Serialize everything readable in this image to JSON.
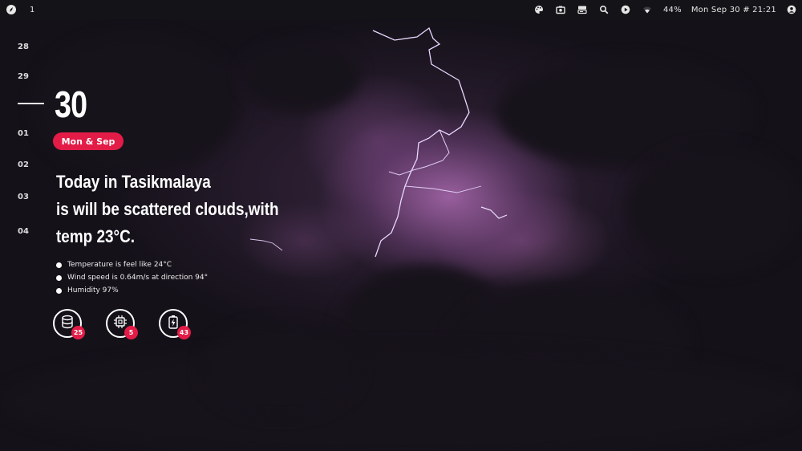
{
  "topbar": {
    "workspace": "1",
    "tray_icons": [
      "palette-icon",
      "camera-icon",
      "panel-icon",
      "search-icon",
      "play-icon",
      "wifi-icon"
    ],
    "volume": "44%",
    "datetime": "Mon Sep 30 # 21:21",
    "user_icon": "user-icon"
  },
  "calendar": {
    "days_before": [
      "28",
      "29"
    ],
    "today": "30",
    "days_after": [
      "01",
      "02",
      "03",
      "04"
    ],
    "day_label": "Mon & Sep"
  },
  "weather": {
    "headline": [
      "Today in Tasikmalaya",
      "is will be scattered clouds,with",
      "temp 23°C."
    ],
    "details": [
      "Temperature is feel like 24°C",
      "Wind speed is 0.64m/s at direction 94°",
      "Humidity 97%"
    ]
  },
  "stats": [
    {
      "icon": "database-icon",
      "value": "25"
    },
    {
      "icon": "cpu-icon",
      "value": "5"
    },
    {
      "icon": "battery-icon",
      "value": "43"
    }
  ],
  "colors": {
    "accent": "#e31c47",
    "bar": "#141418",
    "background": "#15121a"
  }
}
